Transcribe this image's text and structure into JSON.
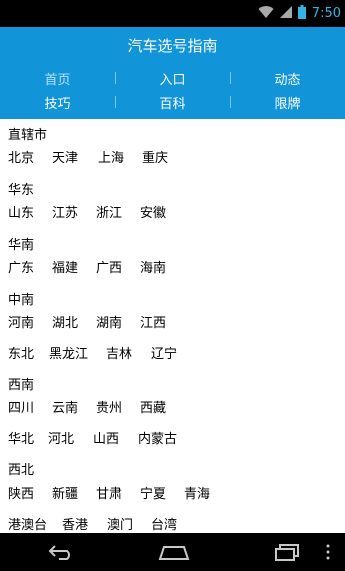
{
  "status_bar": {
    "time": "7:50",
    "icons": [
      "wifi-icon",
      "signal-icon",
      "battery-icon"
    ],
    "accent": "#33b5e5"
  },
  "app": {
    "title": "汽车选号指南",
    "brand_color": "#1294d9"
  },
  "nav": {
    "row1": [
      "首页",
      "入口",
      "动态"
    ],
    "row2": [
      "技巧",
      "百科",
      "限牌"
    ],
    "active": "首页"
  },
  "regions": [
    {
      "label": "直辖市",
      "items": [
        "北京",
        "天津",
        "上海",
        "重庆"
      ]
    },
    {
      "label": "华东",
      "items": [
        "山东",
        "江苏",
        "浙江",
        "安徽"
      ]
    },
    {
      "label": "华南",
      "items": [
        "广东",
        "福建",
        "广西",
        "海南"
      ]
    },
    {
      "label": "中南",
      "items": [
        "河南",
        "湖北",
        "湖南",
        "江西"
      ]
    },
    {
      "label": "东北",
      "items": [
        "黑龙江",
        "吉林",
        "辽宁"
      ],
      "inline": true
    },
    {
      "label": "西南",
      "items": [
        "四川",
        "云南",
        "贵州",
        "西藏"
      ]
    },
    {
      "label": "华北",
      "items": [
        "河北",
        "山西",
        "内蒙古"
      ],
      "inline": true
    },
    {
      "label": "西北",
      "items": [
        "陕西",
        "新疆",
        "甘肃",
        "宁夏",
        "青海"
      ]
    },
    {
      "label": "港澳台",
      "items": [
        "香港",
        "澳门",
        "台湾"
      ],
      "inline": true
    }
  ],
  "system_nav": [
    "back-icon",
    "home-icon",
    "recents-icon",
    "menu-icon"
  ]
}
